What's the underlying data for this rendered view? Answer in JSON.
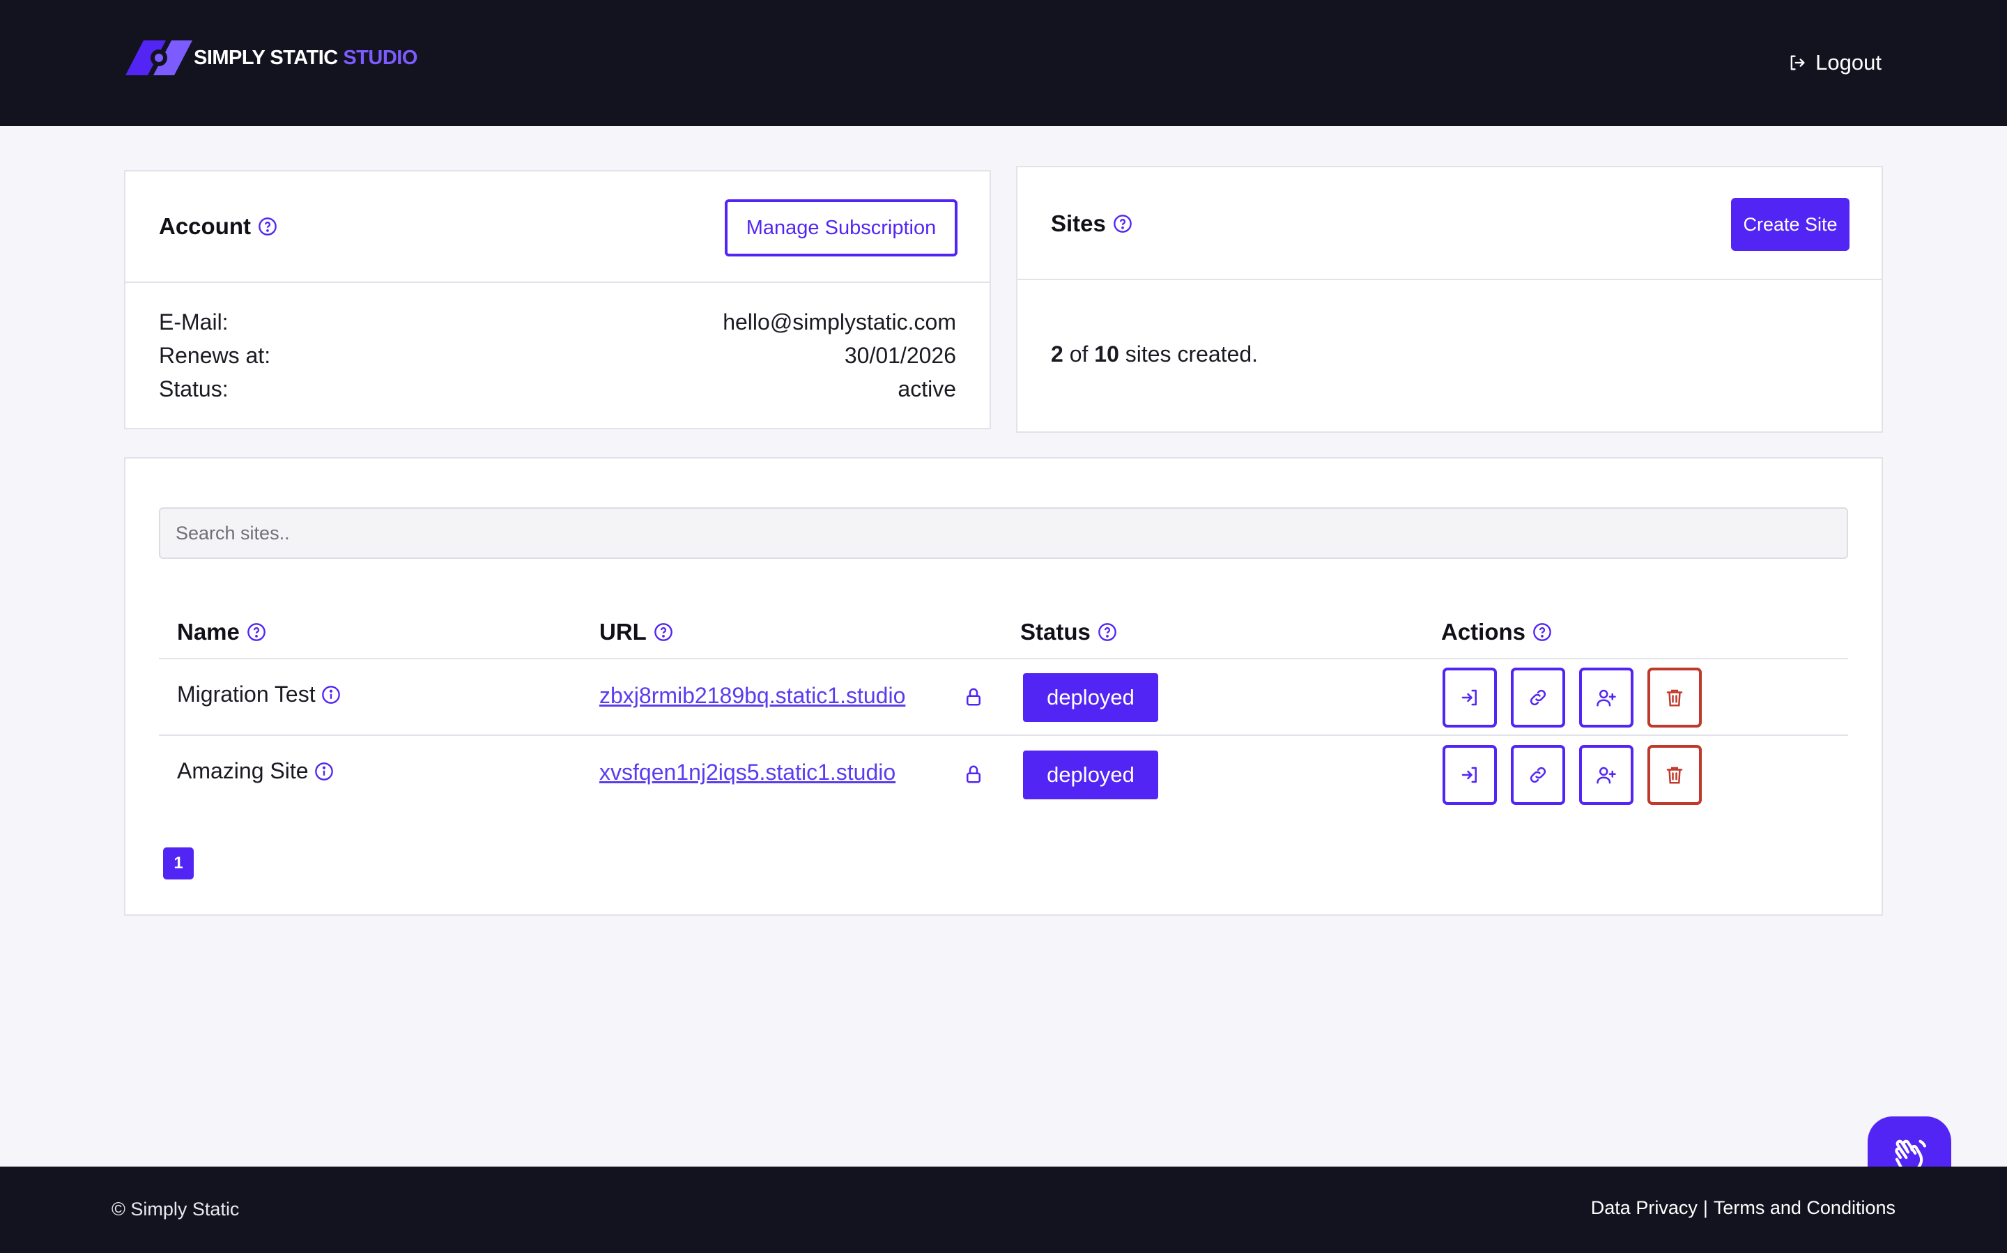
{
  "header": {
    "logo_text_main": "SIMPLY STATIC",
    "logo_text_accent": "STUDIO",
    "logout_label": "Logout"
  },
  "account": {
    "title": "Account",
    "manage_label": "Manage Subscription",
    "rows": [
      {
        "label": "E-Mail:",
        "value": "hello@simplystatic.com"
      },
      {
        "label": "Renews at:",
        "value": "30/01/2026"
      },
      {
        "label": "Status:",
        "value": "active"
      }
    ]
  },
  "sites_card": {
    "title": "Sites",
    "create_label": "Create Site",
    "count_created": "2",
    "count_of": "of",
    "count_total": "10",
    "count_suffix": "sites created."
  },
  "table": {
    "search_placeholder": "Search sites..",
    "columns": [
      "Name",
      "URL",
      "Status",
      "Actions"
    ],
    "rows": [
      {
        "name": "Migration Test",
        "url": "zbxj8rmib2189bq.static1.studio",
        "status": "deployed"
      },
      {
        "name": "Amazing Site",
        "url": "xvsfqen1nj2iqs5.static1.studio",
        "status": "deployed"
      }
    ],
    "current_page": "1"
  },
  "footer": {
    "copyright": "© Simply Static",
    "privacy_label": "Data Privacy",
    "separator": "|",
    "terms_label": "Terms and Conditions"
  },
  "colors": {
    "primary": "#5225f5",
    "danger": "#c0392b",
    "nav_bg": "#13121f",
    "page_bg": "#f6f6fa"
  }
}
